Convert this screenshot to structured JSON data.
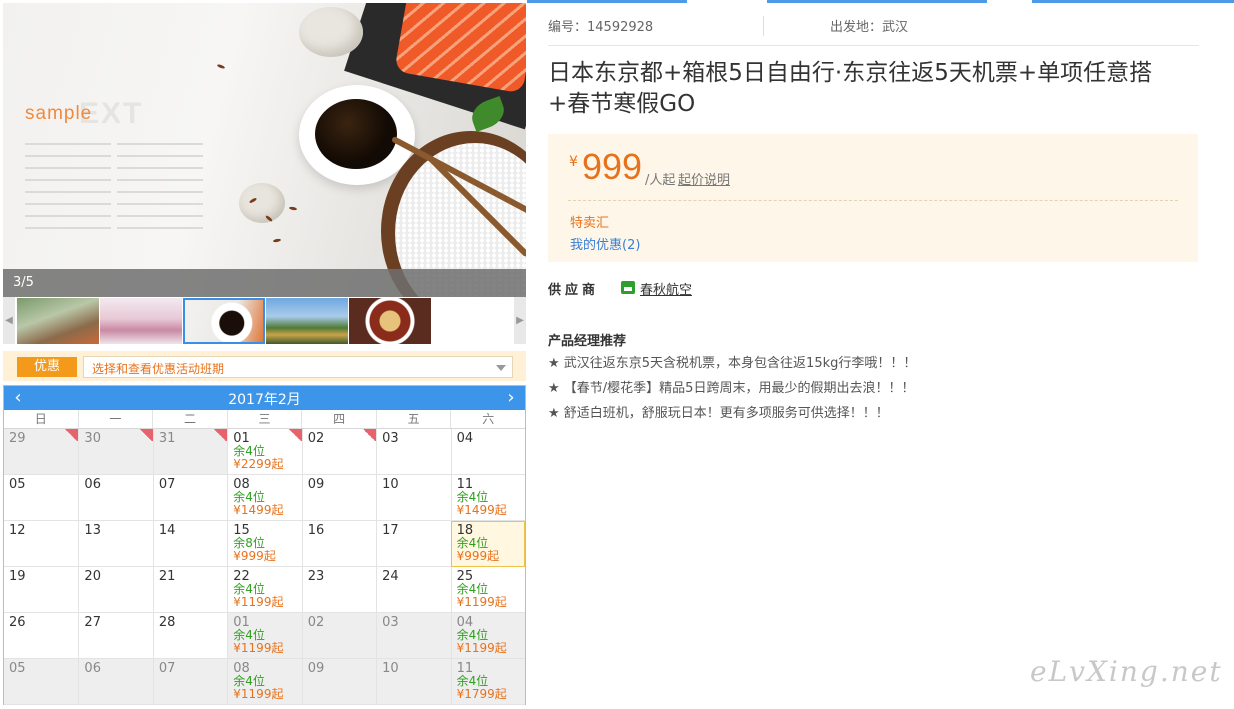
{
  "gallery": {
    "counter": "3/5",
    "hero_text_sample": "sample",
    "hero_text_ext": "EXT"
  },
  "promo": {
    "tag": "优惠",
    "select_text": "选择和查看优惠活动班期"
  },
  "calendar": {
    "title": "2017年2月",
    "weekdays": [
      "日",
      "一",
      "二",
      "三",
      "四",
      "五",
      "六"
    ],
    "rows": [
      [
        {
          "d": "29",
          "muted": true,
          "tag": true
        },
        {
          "d": "30",
          "muted": true,
          "tag": true
        },
        {
          "d": "31",
          "muted": true,
          "tag": true
        },
        {
          "d": "01",
          "seat": "余4位",
          "price": "¥2299起",
          "tag": true
        },
        {
          "d": "02",
          "tag": true
        },
        {
          "d": "03"
        },
        {
          "d": "04"
        }
      ],
      [
        {
          "d": "05"
        },
        {
          "d": "06"
        },
        {
          "d": "07"
        },
        {
          "d": "08",
          "seat": "余4位",
          "price": "¥1499起"
        },
        {
          "d": "09"
        },
        {
          "d": "10"
        },
        {
          "d": "11",
          "seat": "余4位",
          "price": "¥1499起"
        }
      ],
      [
        {
          "d": "12"
        },
        {
          "d": "13"
        },
        {
          "d": "14"
        },
        {
          "d": "15",
          "seat": "余8位",
          "price": "¥999起"
        },
        {
          "d": "16"
        },
        {
          "d": "17"
        },
        {
          "d": "18",
          "seat": "余4位",
          "price": "¥999起",
          "selected": true
        }
      ],
      [
        {
          "d": "19"
        },
        {
          "d": "20"
        },
        {
          "d": "21"
        },
        {
          "d": "22",
          "seat": "余4位",
          "price": "¥1199起"
        },
        {
          "d": "23"
        },
        {
          "d": "24"
        },
        {
          "d": "25",
          "seat": "余4位",
          "price": "¥1199起"
        }
      ],
      [
        {
          "d": "26"
        },
        {
          "d": "27"
        },
        {
          "d": "28"
        },
        {
          "d": "01",
          "seat": "余4位",
          "price": "¥1199起",
          "muted": true
        },
        {
          "d": "02",
          "muted": true
        },
        {
          "d": "03",
          "muted": true
        },
        {
          "d": "04",
          "seat": "余4位",
          "price": "¥1199起",
          "muted": true
        }
      ],
      [
        {
          "d": "05",
          "muted": true
        },
        {
          "d": "06",
          "muted": true
        },
        {
          "d": "07",
          "muted": true
        },
        {
          "d": "08",
          "seat": "余4位",
          "price": "¥1199起",
          "muted": true
        },
        {
          "d": "09",
          "muted": true
        },
        {
          "d": "10",
          "muted": true
        },
        {
          "d": "11",
          "seat": "余4位",
          "price": "¥1799起",
          "muted": true
        }
      ]
    ]
  },
  "product": {
    "code": "编号：14592928",
    "departure": "出发地：武汉",
    "title": "日本东京都+箱根5日自由行·东京往返5天机票+单项任意搭+春节寒假GO",
    "price_currency": "¥",
    "price": "999",
    "price_unit": "/人起",
    "price_explain": "起价说明",
    "sale_label": "特卖汇",
    "my_discount": "我的优惠(2)",
    "supplier_label": "供应商",
    "supplier_name": "春秋航空",
    "rec_title": "产品经理推荐",
    "recommendations": [
      "★ 武汉往返东京5天含税机票，本身包含往返15kg行李哦！！！",
      "★ 【春节/樱花季】精品5日跨周末，用最少的假期出去浪！！！",
      "★ 舒适白班机，舒服玩日本！更有多项服务可供选择！！！"
    ]
  },
  "watermark": "eLvXing.net",
  "colors": {
    "accent_blue": "#3d95ea",
    "price_orange": "#e8721c",
    "seat_green": "#31a022",
    "price_box_bg": "#fdf6e9"
  }
}
